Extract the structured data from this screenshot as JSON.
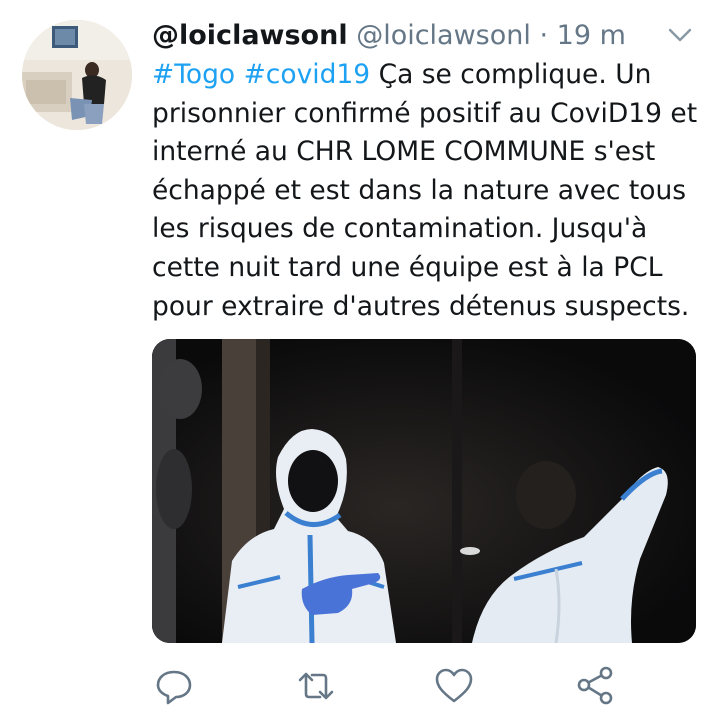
{
  "tweet": {
    "display_name": "@loiclawsonl",
    "handle": "@loiclawsonl",
    "separator": "·",
    "time": "19 m",
    "hashtag1": "#Togo",
    "hashtag2": "#covid19",
    "line1_text": " Ça se complique. Un",
    "line2": "prisonnier confirmé positif au CoviD19 et",
    "line3": "interné au CHR LOME COMMUNE s'est",
    "line4": "échappé et est dans la nature avec tous",
    "line5": "les risques de contamination. Jusqu'à",
    "line6": "cette nuit tard une équipe est à la PCL",
    "line7": "pour extraire d'autres détenus suspects."
  },
  "icons": {
    "caret": "chevron-down-icon",
    "reply": "reply-icon",
    "retweet": "retweet-icon",
    "like": "heart-icon",
    "share": "share-icon"
  },
  "colors": {
    "link": "#1da1f2",
    "secondary": "#657786",
    "text": "#14171a",
    "icon": "#657786"
  }
}
